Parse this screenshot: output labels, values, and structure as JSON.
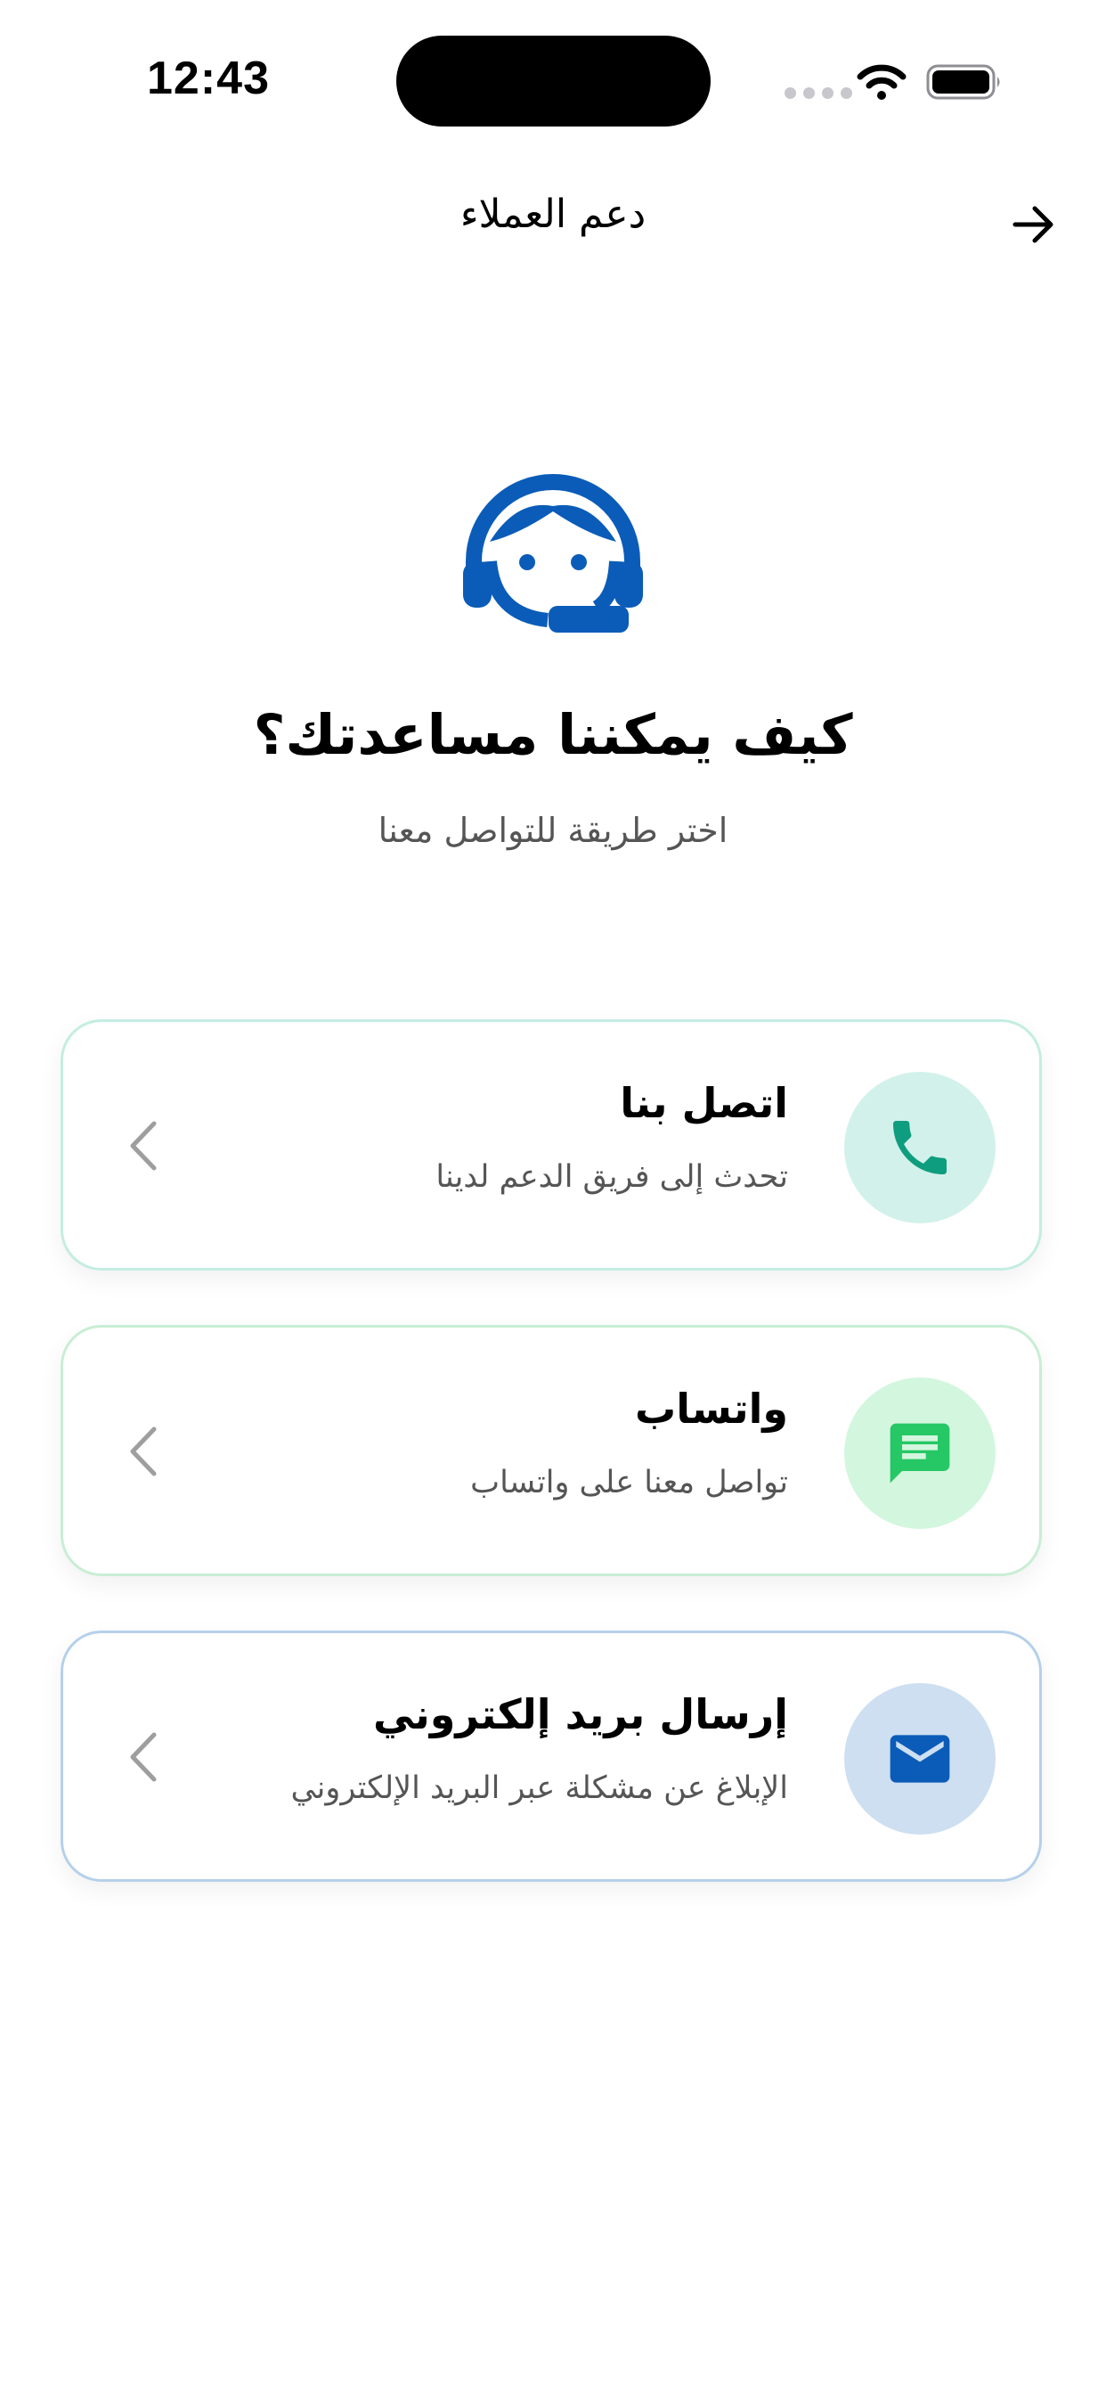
{
  "status_bar": {
    "time": "12:43"
  },
  "nav": {
    "title": "دعم العملاء",
    "back_icon": "arrow-right-icon"
  },
  "hero": {
    "icon": "support-agent-icon",
    "title": "كيف يمكننا مساعدتك؟",
    "subtitle": "اختر طريقة للتواصل معنا"
  },
  "options": [
    {
      "title": "اتصل بنا",
      "description": "تحدث إلى فريق الدعم لدينا",
      "icon": "phone-icon",
      "icon_color": "#0f9d7f",
      "circle_color": "#d2f1ea",
      "border_color": "#c4ede2"
    },
    {
      "title": "واتساب",
      "description": "تواصل معنا على واتساب",
      "icon": "chat-icon",
      "icon_color": "#25c865",
      "circle_color": "#d3f6de",
      "border_color": "#c8eed4"
    },
    {
      "title": "إرسال بريد إلكتروني",
      "description": "الإبلاغ عن مشكلة عبر البريد الإلكتروني",
      "icon": "mail-icon",
      "icon_color": "#0b5cb8",
      "circle_color": "#cddff1",
      "border_color": "#b6d0ea"
    }
  ],
  "colors": {
    "brand_blue": "#0b5cb8",
    "chevron": "#9e9e9e",
    "subtitle_text": "#555555"
  }
}
